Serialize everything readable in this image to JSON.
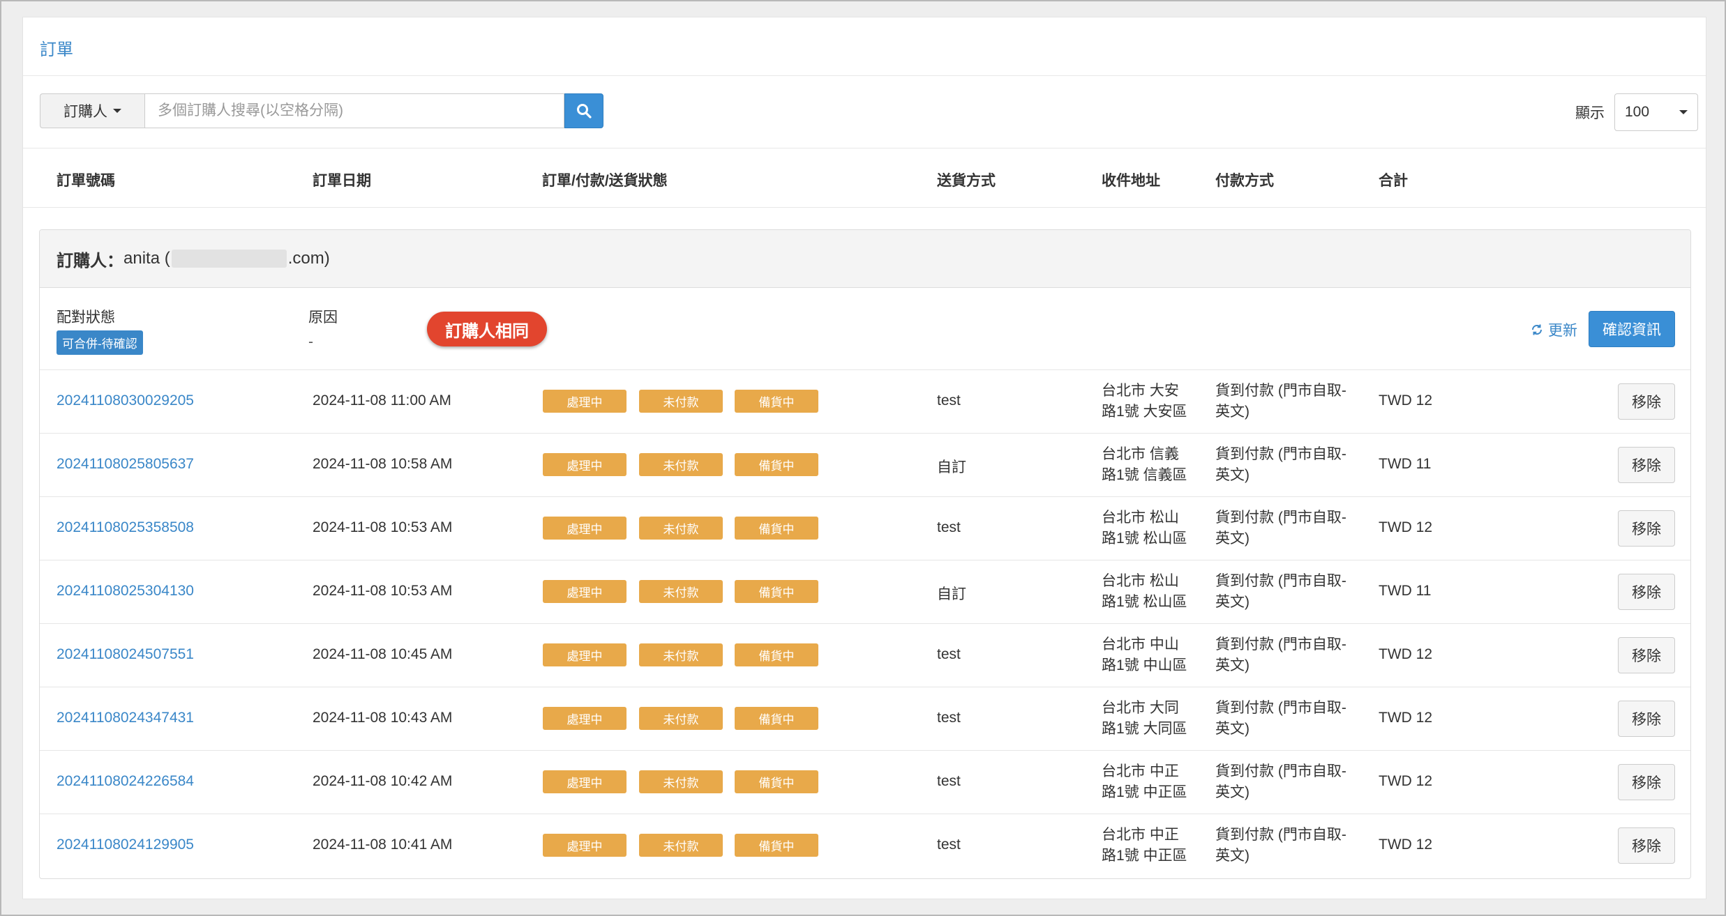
{
  "panel": {
    "title": "訂單"
  },
  "search": {
    "filter_label": "訂購人",
    "placeholder": "多個訂購人搜尋(以空格分隔)",
    "value": ""
  },
  "display": {
    "label": "顯示",
    "value": "100"
  },
  "columns": [
    "訂單號碼",
    "訂單日期",
    "訂單/付款/送貨狀態",
    "送貨方式",
    "收件地址",
    "付款方式",
    "合計"
  ],
  "group": {
    "buyer_label": "訂購人：",
    "buyer_name": "anita (",
    "buyer_email_suffix": ".com)",
    "match_status_label": "配對狀態",
    "match_status_badge": "可合併-待確認",
    "reason_label": "原因",
    "reason_value": "-",
    "reason_pill": "訂購人相同",
    "refresh_label": "更新",
    "confirm_label": "確認資訊"
  },
  "remove_label": "移除",
  "colors": {
    "accent": "#3a87c8",
    "status_tag": "#e8a94a",
    "pill_red": "#e2452e"
  },
  "orders": [
    {
      "number": "20241108030029205",
      "date": "2024-11-08 11:00 AM",
      "statuses": [
        "處理中",
        "未付款",
        "備貨中"
      ],
      "shipping": "test",
      "address_1": "台北市 大安",
      "address_2": "路1號 大安區",
      "payment_1": "貨到付款 (門市自取-",
      "payment_2": "英文)",
      "total": "TWD 12"
    },
    {
      "number": "20241108025805637",
      "date": "2024-11-08 10:58 AM",
      "statuses": [
        "處理中",
        "未付款",
        "備貨中"
      ],
      "shipping": "自訂",
      "address_1": "台北市 信義",
      "address_2": "路1號 信義區",
      "payment_1": "貨到付款 (門市自取-",
      "payment_2": "英文)",
      "total": "TWD 11"
    },
    {
      "number": "20241108025358508",
      "date": "2024-11-08 10:53 AM",
      "statuses": [
        "處理中",
        "未付款",
        "備貨中"
      ],
      "shipping": "test",
      "address_1": "台北市 松山",
      "address_2": "路1號 松山區",
      "payment_1": "貨到付款 (門市自取-",
      "payment_2": "英文)",
      "total": "TWD 12"
    },
    {
      "number": "20241108025304130",
      "date": "2024-11-08 10:53 AM",
      "statuses": [
        "處理中",
        "未付款",
        "備貨中"
      ],
      "shipping": "自訂",
      "address_1": "台北市 松山",
      "address_2": "路1號 松山區",
      "payment_1": "貨到付款 (門市自取-",
      "payment_2": "英文)",
      "total": "TWD 11"
    },
    {
      "number": "20241108024507551",
      "date": "2024-11-08 10:45 AM",
      "statuses": [
        "處理中",
        "未付款",
        "備貨中"
      ],
      "shipping": "test",
      "address_1": "台北市 中山",
      "address_2": "路1號 中山區",
      "payment_1": "貨到付款 (門市自取-",
      "payment_2": "英文)",
      "total": "TWD 12"
    },
    {
      "number": "20241108024347431",
      "date": "2024-11-08 10:43 AM",
      "statuses": [
        "處理中",
        "未付款",
        "備貨中"
      ],
      "shipping": "test",
      "address_1": "台北市 大同",
      "address_2": "路1號 大同區",
      "payment_1": "貨到付款 (門市自取-",
      "payment_2": "英文)",
      "total": "TWD 12"
    },
    {
      "number": "20241108024226584",
      "date": "2024-11-08 10:42 AM",
      "statuses": [
        "處理中",
        "未付款",
        "備貨中"
      ],
      "shipping": "test",
      "address_1": "台北市 中正",
      "address_2": "路1號 中正區",
      "payment_1": "貨到付款 (門市自取-",
      "payment_2": "英文)",
      "total": "TWD 12"
    },
    {
      "number": "20241108024129905",
      "date": "2024-11-08 10:41 AM",
      "statuses": [
        "處理中",
        "未付款",
        "備貨中"
      ],
      "shipping": "test",
      "address_1": "台北市 中正",
      "address_2": "路1號 中正區",
      "payment_1": "貨到付款 (門市自取-",
      "payment_2": "英文)",
      "total": "TWD 12"
    }
  ]
}
